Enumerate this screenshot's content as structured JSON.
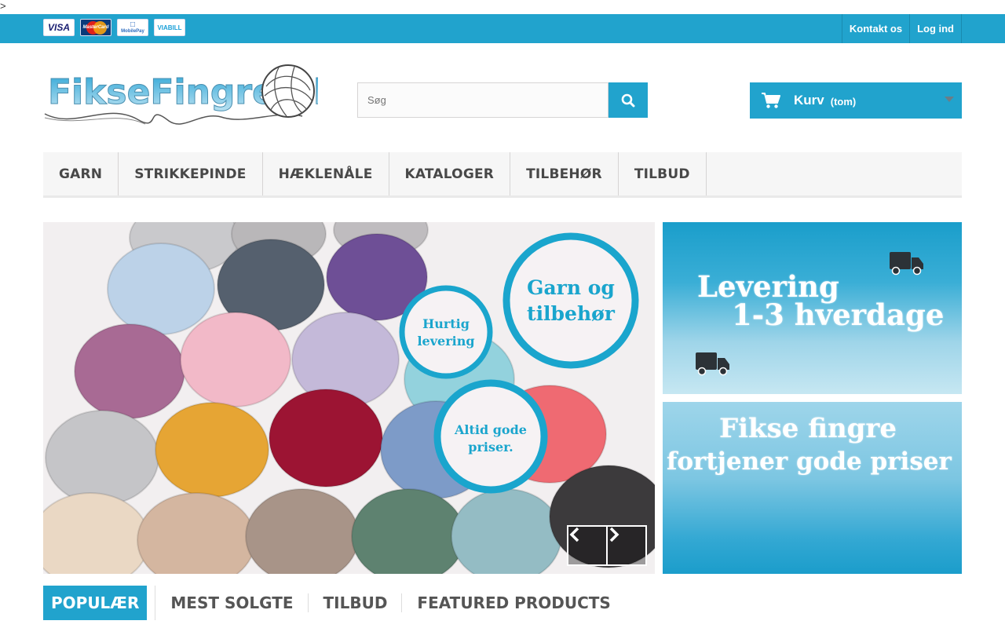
{
  "stray_text": ">",
  "colors": {
    "accent": "#21a3cd",
    "nav_bg": "#f6f6f6"
  },
  "payment_cards": [
    {
      "name": "visa",
      "label": "VISA"
    },
    {
      "name": "mastercard",
      "label": "MasterCard"
    },
    {
      "name": "mobilepay",
      "label": "MobilePay"
    },
    {
      "name": "viabill",
      "label": "VIABILL"
    }
  ],
  "top_links": {
    "contact": "Kontakt os",
    "login": "Log ind"
  },
  "logo": {
    "text": "FikseFingre.dk"
  },
  "search": {
    "placeholder": "Søg",
    "icon": "search-icon"
  },
  "cart": {
    "label": "Kurv",
    "status": "(tom)",
    "icon": "cart-icon"
  },
  "nav": [
    "GARN",
    "STRIKKEPINDE",
    "HÆKLENÅLE",
    "KATALOGER",
    "TILBEHØR",
    "TILBUD"
  ],
  "slider": {
    "badges": {
      "big": [
        "Garn og",
        "tilbehør"
      ],
      "fast": [
        "Hurtig",
        "levering"
      ],
      "prices": [
        "Altid gode",
        "priser."
      ]
    },
    "prev_icon": "chevron-left-icon",
    "next_icon": "chevron-right-icon"
  },
  "banners": {
    "delivery": {
      "line1": "Levering",
      "line2": "1-3 hverdage",
      "icon": "truck-icon"
    },
    "prices": {
      "line1": "Fikse fingre",
      "line2": "fortjener gode priser"
    }
  },
  "tabs": [
    "POPULÆR",
    "MEST SOLGTE",
    "TILBUD",
    "FEATURED PRODUCTS"
  ]
}
